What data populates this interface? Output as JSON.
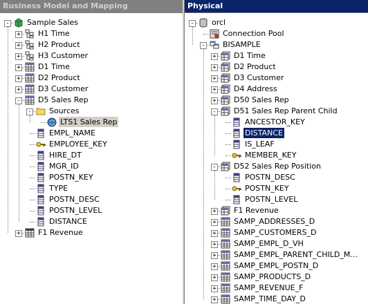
{
  "panes": {
    "bmm": {
      "title": "Business Model and Mapping"
    },
    "physical": {
      "title": "Physical"
    }
  },
  "bmm_tree": [
    {
      "label": "Sample Sales",
      "icon": "business-model-icon",
      "exp": "-"
    },
    {
      "label": "H1 Time",
      "icon": "hierarchy-icon",
      "exp": "+"
    },
    {
      "label": "H2 Product",
      "icon": "hierarchy-icon",
      "exp": "+"
    },
    {
      "label": "H3 Customer",
      "icon": "hierarchy-icon",
      "exp": "+"
    },
    {
      "label": "D1 Time",
      "icon": "table-icon",
      "exp": "+"
    },
    {
      "label": "D2 Product",
      "icon": "table-icon",
      "exp": "+"
    },
    {
      "label": "D3 Customer",
      "icon": "table-icon",
      "exp": "+"
    },
    {
      "label": "D5 Sales Rep",
      "icon": "table-icon",
      "exp": "-"
    },
    {
      "label": "Sources",
      "icon": "folder-icon",
      "exp": "-"
    },
    {
      "label": "LTS1 Sales Rep",
      "icon": "logical-table-source-icon",
      "exp": ""
    },
    {
      "label": "EMPL_NAME",
      "icon": "column-icon",
      "exp": ""
    },
    {
      "label": "EMPLOYEE_KEY",
      "icon": "key-icon",
      "exp": ""
    },
    {
      "label": "HIRE_DT",
      "icon": "column-icon",
      "exp": ""
    },
    {
      "label": "MGR_ID",
      "icon": "column-icon",
      "exp": ""
    },
    {
      "label": "POSTN_KEY",
      "icon": "column-icon",
      "exp": ""
    },
    {
      "label": "TYPE",
      "icon": "column-icon",
      "exp": ""
    },
    {
      "label": "POSTN_DESC",
      "icon": "column-icon",
      "exp": ""
    },
    {
      "label": "POSTN_LEVEL",
      "icon": "column-icon",
      "exp": ""
    },
    {
      "label": "DISTANCE",
      "icon": "column-icon",
      "exp": ""
    },
    {
      "label": "F1 Revenue",
      "icon": "fact-table-icon",
      "exp": "+"
    }
  ],
  "phys_tree": [
    {
      "label": "orcl",
      "icon": "database-icon",
      "exp": "-"
    },
    {
      "label": "Connection Pool",
      "icon": "connection-pool-icon",
      "exp": ""
    },
    {
      "label": "BISAMPLE",
      "icon": "schema-icon",
      "exp": "-"
    },
    {
      "label": "D1 Time",
      "icon": "alias-table-icon",
      "exp": "+"
    },
    {
      "label": "D2 Product",
      "icon": "alias-table-icon",
      "exp": "+"
    },
    {
      "label": "D3 Customer",
      "icon": "alias-table-icon",
      "exp": "+"
    },
    {
      "label": "D4 Address",
      "icon": "alias-table-icon",
      "exp": "+"
    },
    {
      "label": "D50 Sales Rep",
      "icon": "alias-table-icon",
      "exp": "+"
    },
    {
      "label": "D51 Sales Rep Parent Child",
      "icon": "alias-table-icon",
      "exp": "-"
    },
    {
      "label": "ANCESTOR_KEY",
      "icon": "column-icon",
      "exp": ""
    },
    {
      "label": "DISTANCE",
      "icon": "column-icon",
      "exp": ""
    },
    {
      "label": "IS_LEAF",
      "icon": "column-icon",
      "exp": ""
    },
    {
      "label": "MEMBER_KEY",
      "icon": "key-icon",
      "exp": ""
    },
    {
      "label": "D52 Sales Rep Position",
      "icon": "alias-table-icon",
      "exp": "-"
    },
    {
      "label": "POSTN_DESC",
      "icon": "column-icon",
      "exp": ""
    },
    {
      "label": "POSTN_KEY",
      "icon": "key-icon",
      "exp": ""
    },
    {
      "label": "POSTN_LEVEL",
      "icon": "column-icon",
      "exp": ""
    },
    {
      "label": "F1 Revenue",
      "icon": "alias-table-icon",
      "exp": "+"
    },
    {
      "label": "SAMP_ADDRESSES_D",
      "icon": "physical-table-icon",
      "exp": "+"
    },
    {
      "label": "SAMP_CUSTOMERS_D",
      "icon": "physical-table-icon",
      "exp": "+"
    },
    {
      "label": "SAMP_EMPL_D_VH",
      "icon": "physical-table-icon",
      "exp": "+"
    },
    {
      "label": "SAMP_EMPL_PARENT_CHILD_M...",
      "icon": "physical-table-icon",
      "exp": "+"
    },
    {
      "label": "SAMP_EMPL_POSTN_D",
      "icon": "physical-table-icon",
      "exp": "+"
    },
    {
      "label": "SAMP_PRODUCTS_D",
      "icon": "physical-table-icon",
      "exp": "+"
    },
    {
      "label": "SAMP_REVENUE_F",
      "icon": "physical-table-icon",
      "exp": "+"
    },
    {
      "label": "SAMP_TIME_DAY_D",
      "icon": "physical-table-icon",
      "exp": "+"
    }
  ]
}
